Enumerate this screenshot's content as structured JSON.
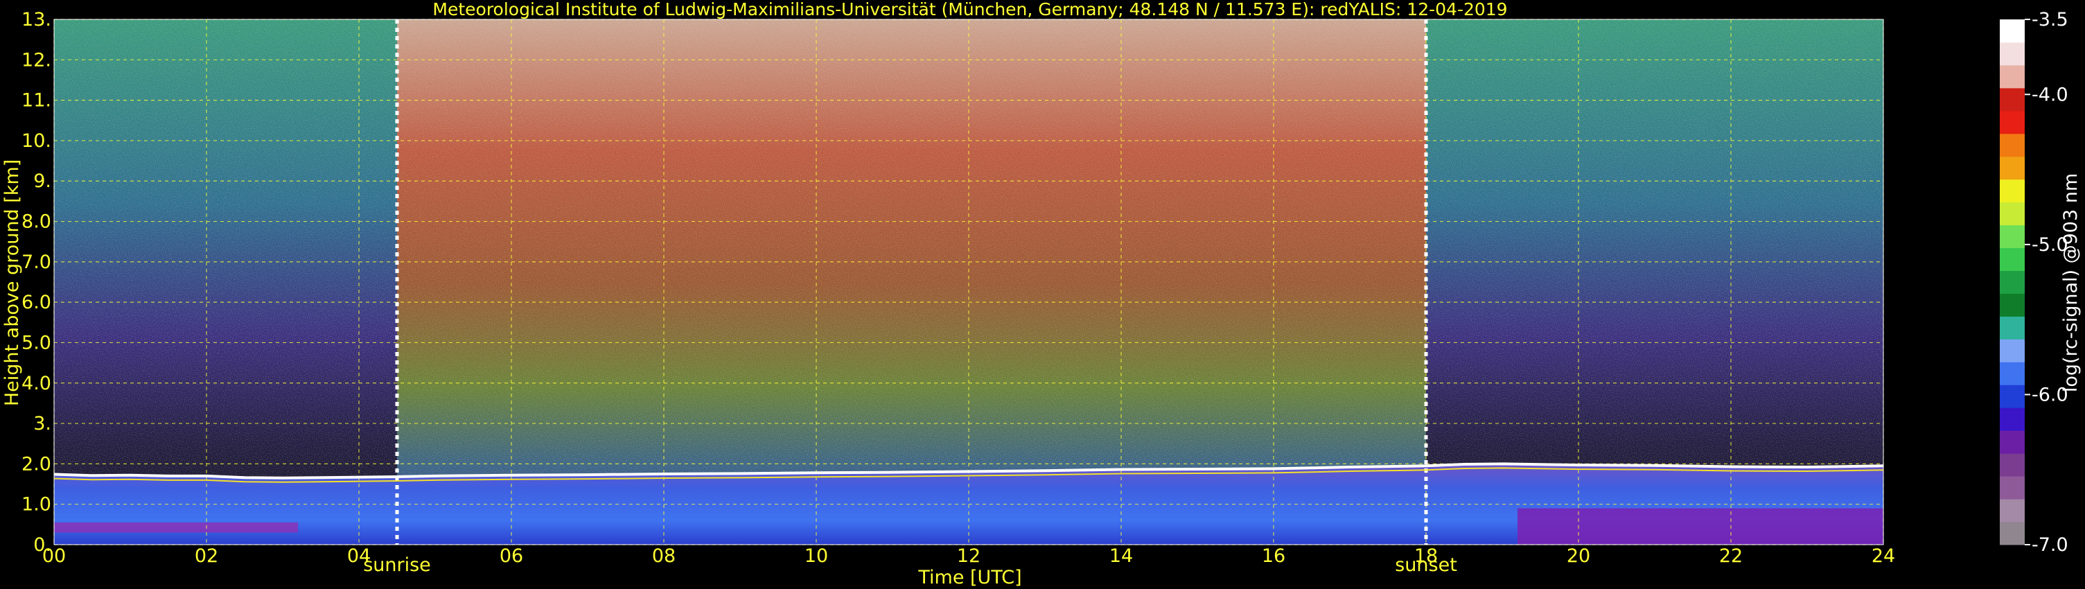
{
  "chart_data": {
    "type": "heatmap",
    "title": "Meteorological Institute of Ludwig-Maximilians-Universität (München, Germany; 48.148 N / 11.573 E):    redYALIS: 12-04-2019",
    "xlabel": "Time [UTC]",
    "ylabel": "Height above ground [km]",
    "xlim": [
      0,
      24
    ],
    "ylim": [
      0,
      13
    ],
    "x_ticks": [
      0,
      2,
      4,
      6,
      8,
      10,
      12,
      14,
      16,
      18,
      20,
      22,
      24
    ],
    "x_tick_labels": [
      "00",
      "02",
      "04",
      "06",
      "08",
      "10",
      "12",
      "14",
      "16",
      "18",
      "20",
      "22",
      "24"
    ],
    "y_ticks": [
      0,
      1,
      2,
      3,
      4,
      5,
      6,
      7,
      8,
      9,
      10,
      11,
      12,
      13
    ],
    "y_tick_labels": [
      "0.",
      "1.0",
      "2.0",
      "3.",
      "4.0",
      "5.0",
      "6.0",
      "7.0",
      "8.0",
      "9.",
      "10.",
      "11.",
      "12.",
      "13."
    ],
    "grid": true,
    "annotations": [
      {
        "label": "sunrise",
        "x": 4.5
      },
      {
        "label": "sunset",
        "x": 18.0
      }
    ],
    "colorbar": {
      "label": "log(rc-signal) @903 nm",
      "range": [
        -7.0,
        -3.5
      ],
      "tick_values": [
        -3.5,
        -4.0,
        -5.0,
        -6.0,
        -7.0
      ],
      "tick_labels": [
        "-3.5",
        "-4.0",
        "-5.0",
        "-6.0",
        "-7.0"
      ],
      "colors": [
        "#8f8690",
        "#a48aa6",
        "#8f5a98",
        "#7a3d8f",
        "#6a1fa5",
        "#3a16c8",
        "#1f3fd6",
        "#3f73f0",
        "#7fa4f6",
        "#2fb39c",
        "#0f7d2a",
        "#1f9f44",
        "#38c94e",
        "#6fdf55",
        "#c8ec36",
        "#eef020",
        "#f2a113",
        "#f17a12",
        "#e71f14",
        "#cf2017",
        "#e8b2a7",
        "#f4dfe0",
        "#ffffff"
      ]
    },
    "series": [
      {
        "name": "",
        "x": [
          0,
          0.5,
          1,
          1.5,
          2,
          2.5,
          3,
          3.5,
          4,
          4.5,
          5,
          6,
          7,
          8,
          9,
          10,
          11,
          12,
          13,
          14,
          15,
          16,
          17,
          18,
          18.5,
          19,
          20,
          21,
          22,
          23,
          24
        ],
        "y": [
          1.74,
          1.71,
          1.72,
          1.7,
          1.7,
          1.66,
          1.65,
          1.66,
          1.67,
          1.68,
          1.7,
          1.72,
          1.73,
          1.75,
          1.76,
          1.78,
          1.79,
          1.81,
          1.83,
          1.86,
          1.87,
          1.88,
          1.92,
          1.95,
          1.99,
          2.0,
          1.97,
          1.96,
          1.93,
          1.92,
          1.95
        ]
      }
    ],
    "features": [
      {
        "label": "",
        "x": [
          0,
          4.5
        ],
        "intensity": "low"
      },
      {
        "label": "",
        "x": [
          4.5,
          18.0
        ],
        "intensity": "high"
      },
      {
        "label": "",
        "x": [
          18.0,
          24
        ],
        "intensity": "low"
      }
    ]
  }
}
